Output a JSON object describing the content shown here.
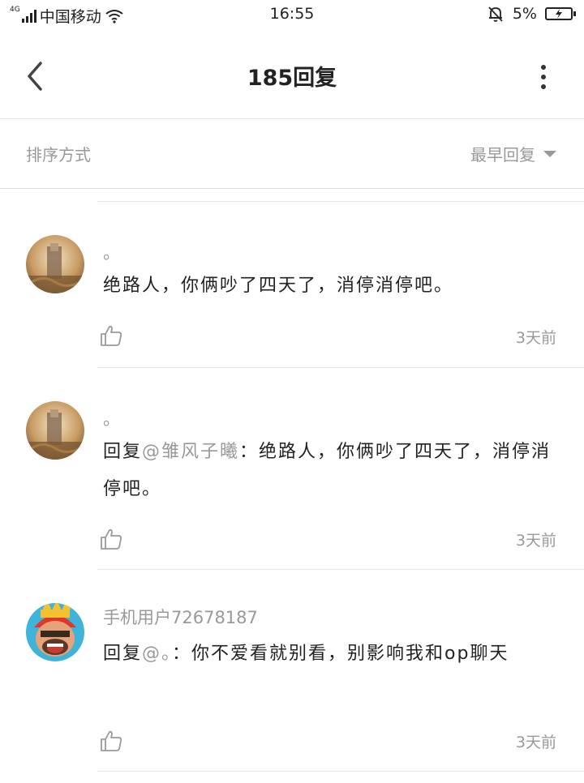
{
  "status_bar": {
    "network_type": "4G",
    "carrier": "中国移动",
    "time": "16:55",
    "battery": "5%",
    "icons": [
      "signal-icon",
      "wifi-icon",
      "mute-bell-icon",
      "battery-charging-icon"
    ]
  },
  "header": {
    "title": "185回复",
    "back_icon": "chevron-left-icon",
    "more_icon": "more-vertical-icon"
  },
  "sort": {
    "label": "排序方式",
    "selected": "最早回复"
  },
  "comments": [
    {
      "username": "。",
      "reply_prefix": "",
      "mention": "",
      "separator": "",
      "text": "绝路人，你俩吵了四天了，消停消停吧。",
      "time": "3天前"
    },
    {
      "username": "。",
      "reply_prefix": "回复",
      "mention": "@雏风子曦",
      "separator": "：",
      "text": "绝路人，你俩吵了四天了，消停消停吧。",
      "time": "3天前"
    },
    {
      "username": "手机用户72678187",
      "reply_prefix": "回复",
      "mention": "@。",
      "separator": "：",
      "text": "你不爱看就别看，别影响我和op聊天",
      "time": "3天前"
    }
  ]
}
